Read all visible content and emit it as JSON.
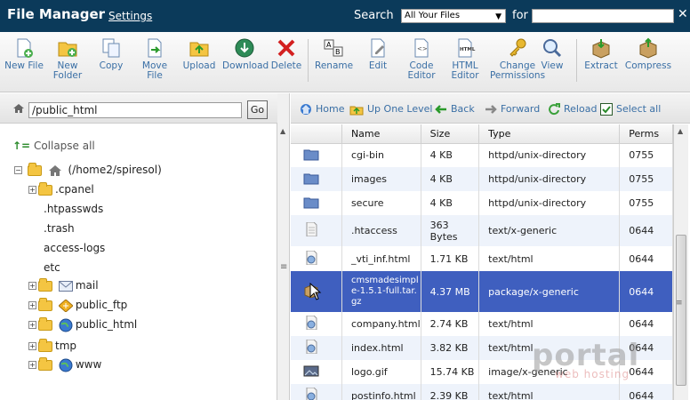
{
  "header": {
    "title": "File Manager",
    "settings_link": "Settings",
    "search_label": "Search",
    "search_scope": "All Your Files",
    "for_label": "for",
    "search_value": ""
  },
  "toolbar": {
    "new_file": [
      "New File"
    ],
    "new_folder": [
      "New",
      "Folder"
    ],
    "copy": [
      "Copy"
    ],
    "move_file": [
      "Move",
      "File"
    ],
    "upload": [
      "Upload"
    ],
    "download": [
      "Download"
    ],
    "delete": [
      "Delete"
    ],
    "rename": [
      "Rename"
    ],
    "edit": [
      "Edit"
    ],
    "code_editor": [
      "Code",
      "Editor"
    ],
    "html_editor": [
      "HTML",
      "Editor"
    ],
    "change_permissions": [
      "Change",
      "Permissions"
    ],
    "view": [
      "View"
    ],
    "extract": [
      "Extract"
    ],
    "compress": [
      "Compress"
    ]
  },
  "path_bar": {
    "path": "/public_html",
    "go_label": "Go"
  },
  "tree": {
    "collapse_all": "Collapse all",
    "root": "(/home2/spiresol)",
    "items": [
      ".cpanel",
      ".htpasswds",
      ".trash",
      "access-logs",
      "etc",
      "mail",
      "public_ftp",
      "public_html",
      "tmp",
      "www"
    ]
  },
  "nav": {
    "home": "Home",
    "up_one_level": "Up One Level",
    "back": "Back",
    "forward": "Forward",
    "reload": "Reload",
    "select_all": "Select all"
  },
  "table": {
    "headers": [
      "Name",
      "Size",
      "Type",
      "Perms"
    ],
    "rows": [
      {
        "name": "cgi-bin",
        "size": "4 KB",
        "type": "httpd/unix-directory",
        "perms": "0755"
      },
      {
        "name": "images",
        "size": "4 KB",
        "type": "httpd/unix-directory",
        "perms": "0755"
      },
      {
        "name": "secure",
        "size": "4 KB",
        "type": "httpd/unix-directory",
        "perms": "0755"
      },
      {
        "name": ".htaccess",
        "size": "363 Bytes",
        "type": "text/x-generic",
        "perms": "0644"
      },
      {
        "name": "_vti_inf.html",
        "size": "1.71 KB",
        "type": "text/html",
        "perms": "0644"
      },
      {
        "name": "cmsmadesimple-1.5.1-full.tar.gz",
        "size": "4.37 MB",
        "type": "package/x-generic",
        "perms": "0644"
      },
      {
        "name": "company.html",
        "size": "2.74 KB",
        "type": "text/html",
        "perms": "0644"
      },
      {
        "name": "index.html",
        "size": "3.82 KB",
        "type": "text/html",
        "perms": "0644"
      },
      {
        "name": "logo.gif",
        "size": "15.74 KB",
        "type": "image/x-generic",
        "perms": "0644"
      },
      {
        "name": "postinfo.html",
        "size": "2.39 KB",
        "type": "text/html",
        "perms": "0644"
      }
    ]
  },
  "watermark": {
    "main": "portal",
    "sub": "web hosting"
  }
}
